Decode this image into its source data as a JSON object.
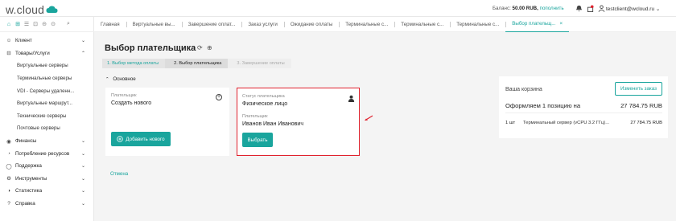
{
  "brand": {
    "logo_text": "w.cloud"
  },
  "topbar": {
    "balance_label": "Баланс:",
    "balance_value": "50.00 RUB,",
    "topup_link": "пополнить",
    "user_email": "testclient@wcloud.ru",
    "user_chevron": "⌄",
    "icons": [
      "notifications-icon",
      "gift-icon",
      "user-icon"
    ]
  },
  "toolbar": {
    "icons": [
      "home-icon",
      "sitemap-icon",
      "list-icon",
      "dashboard-icon",
      "circle-icon",
      "menu-icon",
      "search-icon"
    ]
  },
  "sidebar": {
    "items": [
      {
        "label": "Клиент",
        "icon": "person-icon",
        "glyph": "☺",
        "expanded": false
      },
      {
        "label": "Товары/Услуги",
        "icon": "cart-icon",
        "glyph": "⊟",
        "expanded": true,
        "children": [
          "Виртуальные серверы",
          "Терминальные серверы",
          "VDI - Серверы удаленн...",
          "Виртуальные маршрут...",
          "Технические серверы",
          "Почтовые серверы"
        ]
      },
      {
        "label": "Финансы",
        "icon": "finance-icon",
        "glyph": "◉",
        "expanded": false
      },
      {
        "label": "Потребление ресурсов",
        "icon": "pie-chart-icon",
        "glyph": "◔",
        "expanded": false
      },
      {
        "label": "Поддержка",
        "icon": "support-icon",
        "glyph": "◯",
        "expanded": false
      },
      {
        "label": "Инструменты",
        "icon": "tools-icon",
        "glyph": "⚙",
        "expanded": false
      },
      {
        "label": "Статистика",
        "icon": "stats-icon",
        "glyph": "◑",
        "expanded": false
      },
      {
        "label": "Справка",
        "icon": "help-icon",
        "glyph": "?",
        "expanded": false
      }
    ]
  },
  "tabs": [
    {
      "label": "Главная"
    },
    {
      "label": "Виртуальные вы..."
    },
    {
      "label": "Завершение оплат..."
    },
    {
      "label": "Заказ услуги"
    },
    {
      "label": "Ожидание оплаты"
    },
    {
      "label": "Терминальные с..."
    },
    {
      "label": "Терминальные с..."
    },
    {
      "label": "Терминальные с..."
    },
    {
      "label": "Выбор плательщ...",
      "active": true,
      "close": "×"
    }
  ],
  "page": {
    "title": "Выбор плательщика",
    "steps": [
      "1. Выбор метода оплаты",
      "2. Выбор плательщика",
      "3. Завершение оплаты"
    ],
    "section_caret": "⌃",
    "section": "Основное",
    "new_payer_card": {
      "label": "Плательщик",
      "value": "Создать нового",
      "add_button": "Добавить нового",
      "add_glyph": "+"
    },
    "existing_payer_card": {
      "status_label": "Статус плательщика",
      "status_value": "Физическое лицо",
      "payer_label": "Плательщик",
      "payer_value": "Иванов Иван Иванович",
      "select_button": "Выбрать"
    },
    "cancel": "Отмена"
  },
  "cart": {
    "title": "Ваша корзина",
    "edit_button": "Изменить заказ",
    "summary": "Оформляем 1 позицию на",
    "total": "27 784.75 RUB",
    "line": {
      "qty": "1 шт",
      "name": "Терминальный сервер (vCPU 3.2 ГГц)...",
      "price": "27 784.75 RUB"
    }
  },
  "colors": {
    "accent": "#1aa59d",
    "highlight": "#e0222e"
  }
}
